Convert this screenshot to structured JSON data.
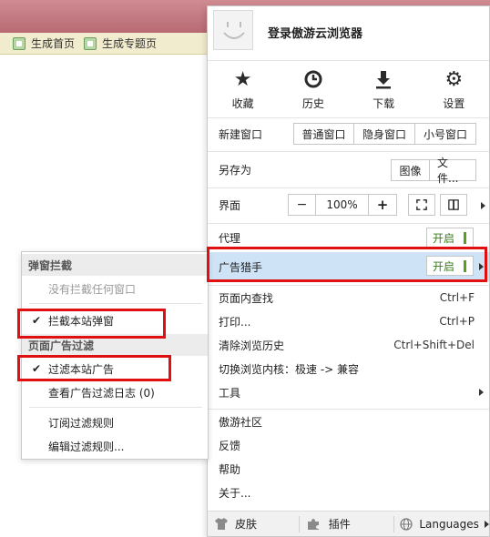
{
  "bookmarks": [
    {
      "label": "生成首页",
      "icon": "bookmark-page-icon"
    },
    {
      "label": "生成专题页",
      "icon": "bookmark-page-icon"
    }
  ],
  "menu": {
    "login_text": "登录傲游云浏览器",
    "quick_actions": [
      {
        "label": "收藏",
        "icon": "star-icon"
      },
      {
        "label": "历史",
        "icon": "clock-icon"
      },
      {
        "label": "下载",
        "icon": "download-icon"
      },
      {
        "label": "设置",
        "icon": "gear-icon"
      }
    ],
    "new_window": {
      "label": "新建窗口",
      "buttons": [
        "普通窗口",
        "隐身窗口",
        "小号窗口"
      ]
    },
    "save_as": {
      "label": "另存为",
      "buttons": [
        "图像",
        "文件..."
      ]
    },
    "ui": {
      "label": "界面",
      "zoom_minus": "−",
      "zoom_value": "100%",
      "zoom_plus": "+"
    },
    "proxy": {
      "label": "代理",
      "toggle": "开启"
    },
    "ad_hunter": {
      "label": "广告猎手",
      "toggle": "开启"
    },
    "find": {
      "label": "页面内查找",
      "shortcut": "Ctrl+F"
    },
    "print": {
      "label": "打印...",
      "shortcut": "Ctrl+P"
    },
    "clear_history": {
      "label": "清除浏览历史",
      "shortcut": "Ctrl+Shift+Del"
    },
    "switch_core": {
      "label": "切换浏览内核：极速 -> 兼容"
    },
    "tools": {
      "label": "工具"
    },
    "community": {
      "label": "傲游社区"
    },
    "feedback": {
      "label": "反馈"
    },
    "help": {
      "label": "帮助"
    },
    "about": {
      "label": "关于..."
    },
    "footer": {
      "skin": "皮肤",
      "plugins": "插件",
      "languages": "Languages"
    }
  },
  "submenu": {
    "popup_header": "弹窗拦截",
    "no_popups": "没有拦截任何窗口",
    "block_popups": "拦截本站弹窗",
    "ad_filter_header": "页面广告过滤",
    "filter_ads": "过滤本站广告",
    "view_log": "查看广告过滤日志 (0)",
    "subscribe_rules": "订阅过滤规则",
    "edit_rules": "编辑过滤规则..."
  },
  "colors": {
    "highlight": "#cfe3f7",
    "annotation_red": "#e01010",
    "toggle_green": "#5aa020"
  }
}
